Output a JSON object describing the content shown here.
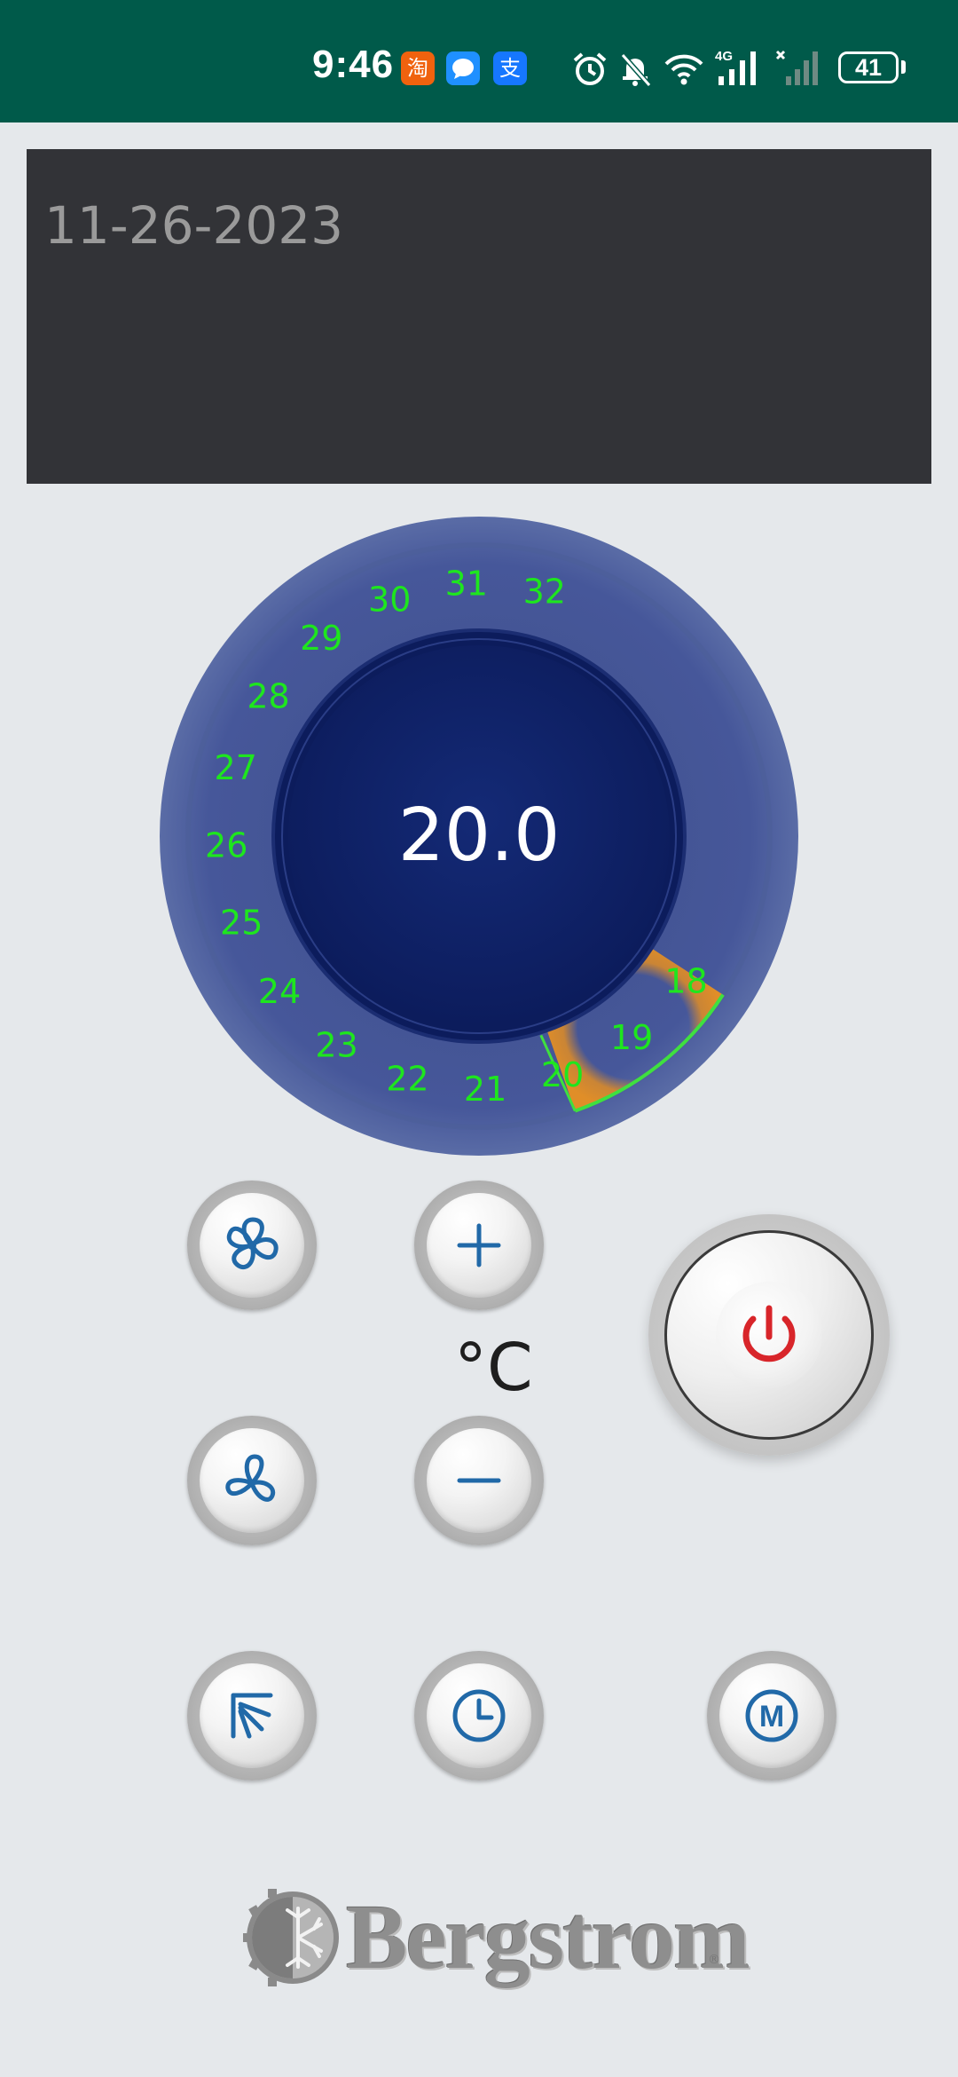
{
  "status_bar": {
    "time": "9:46",
    "apps": [
      {
        "name": "taobao-icon",
        "glyph": "淘",
        "color": "#f0620e"
      },
      {
        "name": "message-icon",
        "glyph": "",
        "color": "#1f90ff"
      },
      {
        "name": "alipay-icon",
        "glyph": "支",
        "color": "#1677ff"
      }
    ],
    "network": "4G",
    "battery": "41"
  },
  "date_display": {
    "date": "11-26-2023"
  },
  "dial": {
    "current_value": "20.0",
    "scale": [
      "18",
      "19",
      "20",
      "21",
      "22",
      "23",
      "24",
      "25",
      "26",
      "27",
      "28",
      "29",
      "30",
      "31",
      "32"
    ],
    "scale_min": 18,
    "scale_max": 32,
    "set_level": 20,
    "label_color": "#1ee61e",
    "arc_color": "#d98a2a"
  },
  "controls": {
    "unit": "°C",
    "buttons": [
      {
        "name": "fan-speed-high-button",
        "icon": "fan-icon"
      },
      {
        "name": "temperature-up-button",
        "icon": "plus-icon"
      },
      {
        "name": "fan-speed-low-button",
        "icon": "fan-small-icon"
      },
      {
        "name": "temperature-down-button",
        "icon": "minus-icon"
      },
      {
        "name": "air-direction-button",
        "icon": "air-flow-icon"
      },
      {
        "name": "timer-button",
        "icon": "clock-icon"
      },
      {
        "name": "mode-button",
        "icon": "mode-icon",
        "glyph": "M"
      }
    ],
    "power": {
      "icon": "power-icon",
      "color": "#d8252a"
    }
  },
  "logo": {
    "text": "Bergstrom",
    "reg": "®"
  },
  "colors": {
    "status_bar_bg": "#005a4a",
    "date_panel_bg": "#323337",
    "dial_outer": "#4b5e97",
    "dial_inner": "#0f1f63",
    "icon_blue": "#2169a8"
  }
}
